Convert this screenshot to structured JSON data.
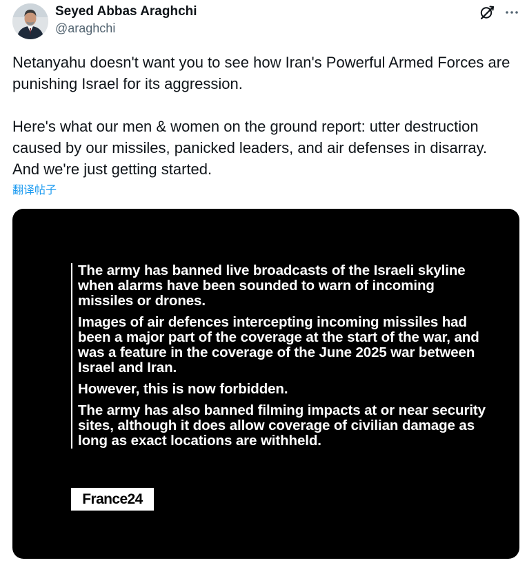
{
  "author": {
    "display_name": "Seyed Abbas Araghchi",
    "handle": "@araghchi",
    "avatar_icon": "profile-photo"
  },
  "toolbar": {
    "grok_icon": "grok-icon",
    "more_icon": "more-icon"
  },
  "tweet": {
    "paragraphs": [
      "Netanyahu doesn't want you to see how Iran's Powerful Armed Forces are punishing Israel for its aggression.",
      "Here's what our men & women on the ground report: utter destruction caused by our missiles, panicked leaders, and air defenses in disarray. And we're just getting started."
    ],
    "translate_label": "翻译帖子"
  },
  "media": {
    "quote_paragraphs": [
      "The army has banned live broadcasts of the Israeli skyline when alarms have been sounded to warn of incoming missiles or drones.",
      "Images of air defences intercepting incoming missiles had been a major part of the coverage at the start of the war, and was a feature in the coverage of the June 2025 war between Israel and Iran.",
      "However, this is now forbidden.",
      "The army has also banned filming impacts at or near security sites, although it does allow coverage of civilian damage as long as exact locations are withheld."
    ],
    "source_logo": "France24"
  },
  "colors": {
    "text_primary": "#0f1419",
    "text_secondary": "#536471",
    "link": "#1d9bf0",
    "media_background": "#000000",
    "media_text": "#ffffff"
  }
}
